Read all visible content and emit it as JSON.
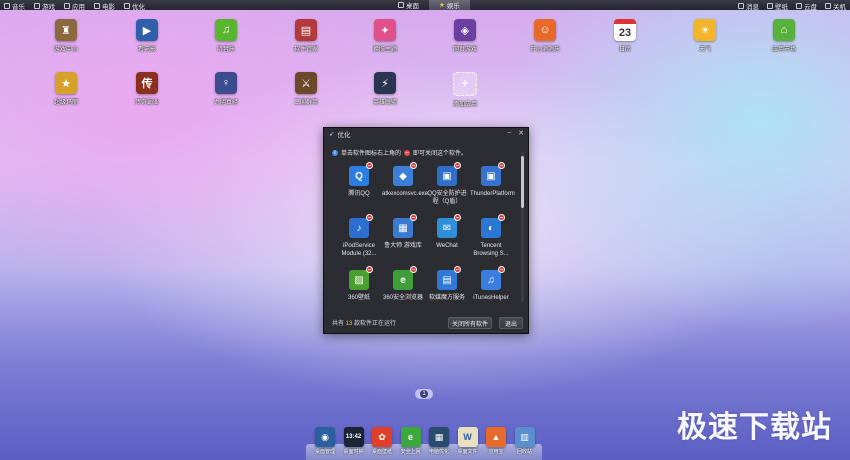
{
  "topbar": {
    "left_items": [
      {
        "label": "音乐",
        "icon": "music-icon"
      },
      {
        "label": "游戏",
        "icon": "game-icon"
      },
      {
        "label": "应用",
        "icon": "apps-icon"
      },
      {
        "label": "电影",
        "icon": "movie-icon"
      },
      {
        "label": "优化",
        "icon": "optimize-icon"
      }
    ],
    "tabs": [
      {
        "label": "桌面",
        "active": false
      },
      {
        "label": "娱乐",
        "active": true
      }
    ],
    "right_items": [
      {
        "label": "消息"
      },
      {
        "label": "壁纸"
      },
      {
        "label": "云盘"
      },
      {
        "label": "关机"
      }
    ]
  },
  "desktop_icons": [
    {
      "label": "游戏中心",
      "color": "#8a6a3c",
      "glyph": "♜"
    },
    {
      "label": "看电影",
      "color": "#2f5fa8",
      "glyph": "▶"
    },
    {
      "label": "听音乐",
      "color": "#58b52e",
      "glyph": "♫"
    },
    {
      "label": "软件管家",
      "color": "#b23a3a",
      "glyph": "▤"
    },
    {
      "label": "换肤主题",
      "color": "#e0508a",
      "glyph": "✦"
    },
    {
      "label": "网页游戏",
      "color": "#6a3fa0",
      "glyph": "◈"
    },
    {
      "label": "开心消消乐",
      "color": "#e86a2a",
      "glyph": "☺"
    },
    {
      "label": "日历",
      "color": "#ffffff",
      "glyph": "23"
    },
    {
      "label": "天气",
      "color": "#f2b52a",
      "glyph": "☀"
    },
    {
      "label": "应用市场",
      "color": "#57b13c",
      "glyph": "⌂"
    },
    {
      "label": "超级玛丽",
      "color": "#d6a12a",
      "glyph": "★"
    },
    {
      "label": "传奇霸业",
      "color": "#8c2f1f",
      "glyph": "传"
    },
    {
      "label": "九阴真经",
      "color": "#3b4c8f",
      "glyph": "♀"
    },
    {
      "label": "三国群英",
      "color": "#6a4a2a",
      "glyph": "⚔"
    },
    {
      "label": "英雄联盟",
      "color": "#2a3550",
      "glyph": "⚡"
    },
    {
      "label": "添加应用",
      "color": "rgba(255,255,255,0.25)",
      "glyph": "+"
    }
  ],
  "window": {
    "title": "优化",
    "info_before": "单击软件图标右上角的",
    "info_after": "即可关闭这个软件。",
    "apps": [
      {
        "label": "腾讯QQ",
        "color": "#2b7de0",
        "glyph": "Q"
      },
      {
        "label": "atkexcomsvc.exe",
        "color": "#3b7fd8",
        "glyph": "◆"
      },
      {
        "label": "QQ安全防护进程（Q盾）",
        "color": "#2f6fc8",
        "glyph": "▣"
      },
      {
        "label": "ThunderPlatform",
        "color": "#3573cf",
        "glyph": "▣"
      },
      {
        "label": "iPodService Module (32...",
        "color": "#2d6fd0",
        "glyph": "♪"
      },
      {
        "label": "鲁大师 游戏库",
        "color": "#3a7ad0",
        "glyph": "▦"
      },
      {
        "label": "WeChat",
        "color": "#2f8fd8",
        "glyph": "✉"
      },
      {
        "label": "Tencent Browsing S...",
        "color": "#2a78d4",
        "glyph": "◐"
      },
      {
        "label": "360壁纸",
        "color": "#4aa02e",
        "glyph": "▨"
      },
      {
        "label": "360安全浏览器",
        "color": "#3f9e3a",
        "glyph": "e"
      },
      {
        "label": "软媒魔方服务",
        "color": "#2f7ad8",
        "glyph": "▤"
      },
      {
        "label": "iTunesHelper",
        "color": "#3b7ee0",
        "glyph": "♫"
      }
    ],
    "footer_before": "共有",
    "footer_count": "13",
    "footer_after": "款软件正在运行",
    "close_all_label": "关闭所有软件",
    "exit_label": "退出"
  },
  "page_indicator": "1",
  "dock": [
    {
      "label": "桌面管理",
      "color": "#2a5fa0",
      "glyph": "◉"
    },
    {
      "label": "桌面时钟",
      "color": "#1d2433",
      "glyph": "13:42"
    },
    {
      "label": "桌面壁纸",
      "color": "#e0402a",
      "glyph": "✿"
    },
    {
      "label": "安全上网",
      "color": "#3aa83a",
      "glyph": "e"
    },
    {
      "label": "电脑优化",
      "color": "#2a4a70",
      "glyph": "▦"
    },
    {
      "label": "桌面文件",
      "color": "#e8e0c0",
      "glyph": "W"
    },
    {
      "label": "应用宝",
      "color": "#e86a2a",
      "glyph": "▲"
    },
    {
      "label": "回收站",
      "color": "#5a8fd0",
      "glyph": "▥"
    }
  ],
  "watermark": "极速下载站"
}
